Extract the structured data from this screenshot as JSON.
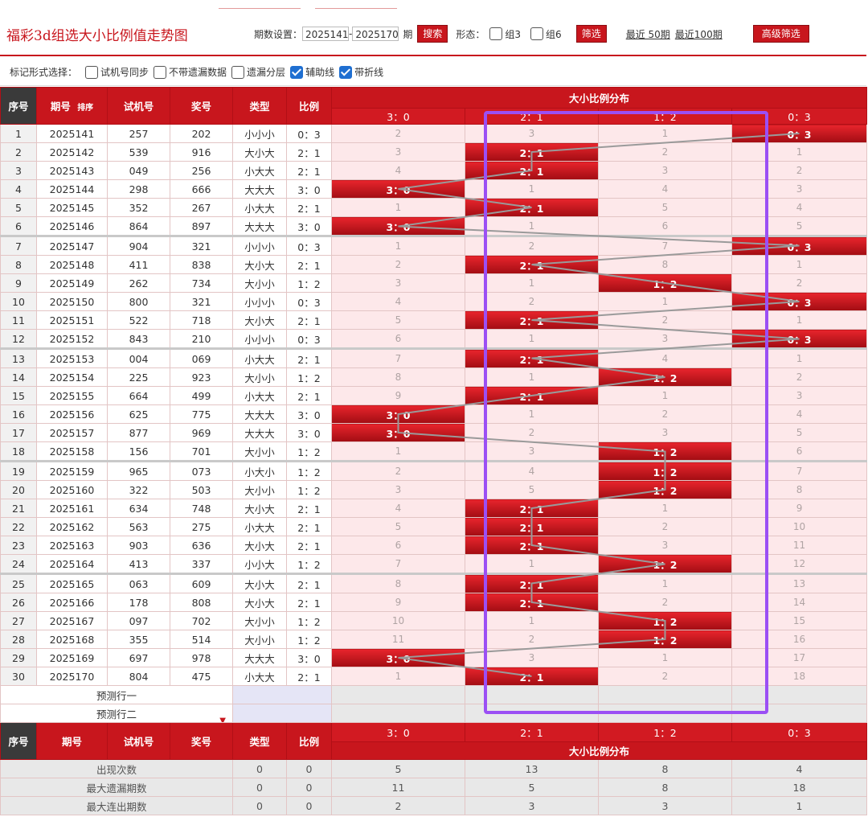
{
  "header": {
    "title": "福彩3d组选大小比例值走势图",
    "period_label": "期数设置：",
    "from": "2025141",
    "dash": "-",
    "to": "2025170",
    "qi": "期",
    "search": "搜索",
    "form_label": "形态：",
    "zu3": "组3",
    "zu6": "组6",
    "filter": "筛选",
    "recent50": "最近 50期",
    "recent100": "最近100期",
    "advanced": "高级筛选"
  },
  "markbar": {
    "label": "标记形式选择：",
    "opt1": "试机号同步",
    "opt2": "不带遗漏数据",
    "opt3": "遗漏分层",
    "opt4": "辅助线",
    "opt5": "带折线"
  },
  "table": {
    "h_seq": "序号",
    "h_issue": "期号",
    "h_sort": "排序",
    "h_trial": "试机号",
    "h_prize": "奖号",
    "h_type": "类型",
    "h_ratio": "比例",
    "h_dist": "大小比例分布",
    "ratios": [
      "3：0",
      "2：1",
      "1：2",
      "0：3"
    ],
    "rows": [
      {
        "seq": "1",
        "issue": "2025141",
        "trial": "257",
        "prize": "202",
        "type": "小小小",
        "ratio": "0：3",
        "c": [
          "2",
          "3",
          "1",
          "0：3"
        ],
        "hit": 3
      },
      {
        "seq": "2",
        "issue": "2025142",
        "trial": "539",
        "prize": "916",
        "type": "大小大",
        "ratio": "2：1",
        "c": [
          "3",
          "2：1",
          "2",
          "1"
        ],
        "hit": 1
      },
      {
        "seq": "3",
        "issue": "2025143",
        "trial": "049",
        "prize": "256",
        "type": "小大大",
        "ratio": "2：1",
        "c": [
          "4",
          "2：1",
          "3",
          "2"
        ],
        "hit": 1
      },
      {
        "seq": "4",
        "issue": "2025144",
        "trial": "298",
        "prize": "666",
        "type": "大大大",
        "ratio": "3：0",
        "c": [
          "3：0",
          "1",
          "4",
          "3"
        ],
        "hit": 0
      },
      {
        "seq": "5",
        "issue": "2025145",
        "trial": "352",
        "prize": "267",
        "type": "小大大",
        "ratio": "2：1",
        "c": [
          "1",
          "2：1",
          "5",
          "4"
        ],
        "hit": 1
      },
      {
        "seq": "6",
        "issue": "2025146",
        "trial": "864",
        "prize": "897",
        "type": "大大大",
        "ratio": "3：0",
        "c": [
          "3：0",
          "1",
          "6",
          "5"
        ],
        "hit": 0
      },
      {
        "seq": "7",
        "issue": "2025147",
        "trial": "904",
        "prize": "321",
        "type": "小小小",
        "ratio": "0：3",
        "c": [
          "1",
          "2",
          "7",
          "0：3"
        ],
        "hit": 3
      },
      {
        "seq": "8",
        "issue": "2025148",
        "trial": "411",
        "prize": "838",
        "type": "大小大",
        "ratio": "2：1",
        "c": [
          "2",
          "2：1",
          "8",
          "1"
        ],
        "hit": 1
      },
      {
        "seq": "9",
        "issue": "2025149",
        "trial": "262",
        "prize": "734",
        "type": "大小小",
        "ratio": "1：2",
        "c": [
          "3",
          "1",
          "1：2",
          "2"
        ],
        "hit": 2
      },
      {
        "seq": "10",
        "issue": "2025150",
        "trial": "800",
        "prize": "321",
        "type": "小小小",
        "ratio": "0：3",
        "c": [
          "4",
          "2",
          "1",
          "0：3"
        ],
        "hit": 3
      },
      {
        "seq": "11",
        "issue": "2025151",
        "trial": "522",
        "prize": "718",
        "type": "大小大",
        "ratio": "2：1",
        "c": [
          "5",
          "2：1",
          "2",
          "1"
        ],
        "hit": 1
      },
      {
        "seq": "12",
        "issue": "2025152",
        "trial": "843",
        "prize": "210",
        "type": "小小小",
        "ratio": "0：3",
        "c": [
          "6",
          "1",
          "3",
          "0：3"
        ],
        "hit": 3
      },
      {
        "seq": "13",
        "issue": "2025153",
        "trial": "004",
        "prize": "069",
        "type": "小大大",
        "ratio": "2：1",
        "c": [
          "7",
          "2：1",
          "4",
          "1"
        ],
        "hit": 1
      },
      {
        "seq": "14",
        "issue": "2025154",
        "trial": "225",
        "prize": "923",
        "type": "大小小",
        "ratio": "1：2",
        "c": [
          "8",
          "1",
          "1：2",
          "2"
        ],
        "hit": 2
      },
      {
        "seq": "15",
        "issue": "2025155",
        "trial": "664",
        "prize": "499",
        "type": "小大大",
        "ratio": "2：1",
        "c": [
          "9",
          "2：1",
          "1",
          "3"
        ],
        "hit": 1
      },
      {
        "seq": "16",
        "issue": "2025156",
        "trial": "625",
        "prize": "775",
        "type": "大大大",
        "ratio": "3：0",
        "c": [
          "3：0",
          "1",
          "2",
          "4"
        ],
        "hit": 0
      },
      {
        "seq": "17",
        "issue": "2025157",
        "trial": "877",
        "prize": "969",
        "type": "大大大",
        "ratio": "3：0",
        "c": [
          "3：0",
          "2",
          "3",
          "5"
        ],
        "hit": 0
      },
      {
        "seq": "18",
        "issue": "2025158",
        "trial": "156",
        "prize": "701",
        "type": "大小小",
        "ratio": "1：2",
        "c": [
          "1",
          "3",
          "1：2",
          "6"
        ],
        "hit": 2
      },
      {
        "seq": "19",
        "issue": "2025159",
        "trial": "965",
        "prize": "073",
        "type": "小大小",
        "ratio": "1：2",
        "c": [
          "2",
          "4",
          "1：2",
          "7"
        ],
        "hit": 2
      },
      {
        "seq": "20",
        "issue": "2025160",
        "trial": "322",
        "prize": "503",
        "type": "大小小",
        "ratio": "1：2",
        "c": [
          "3",
          "5",
          "1：2",
          "8"
        ],
        "hit": 2
      },
      {
        "seq": "21",
        "issue": "2025161",
        "trial": "634",
        "prize": "748",
        "type": "大小大",
        "ratio": "2：1",
        "c": [
          "4",
          "2：1",
          "1",
          "9"
        ],
        "hit": 1
      },
      {
        "seq": "22",
        "issue": "2025162",
        "trial": "563",
        "prize": "275",
        "type": "小大大",
        "ratio": "2：1",
        "c": [
          "5",
          "2：1",
          "2",
          "10"
        ],
        "hit": 1
      },
      {
        "seq": "23",
        "issue": "2025163",
        "trial": "903",
        "prize": "636",
        "type": "大小大",
        "ratio": "2：1",
        "c": [
          "6",
          "2：1",
          "3",
          "11"
        ],
        "hit": 1
      },
      {
        "seq": "24",
        "issue": "2025164",
        "trial": "413",
        "prize": "337",
        "type": "小小大",
        "ratio": "1：2",
        "c": [
          "7",
          "1",
          "1：2",
          "12"
        ],
        "hit": 2
      },
      {
        "seq": "25",
        "issue": "2025165",
        "trial": "063",
        "prize": "609",
        "type": "大小大",
        "ratio": "2：1",
        "c": [
          "8",
          "2：1",
          "1",
          "13"
        ],
        "hit": 1
      },
      {
        "seq": "26",
        "issue": "2025166",
        "trial": "178",
        "prize": "808",
        "type": "大小大",
        "ratio": "2：1",
        "c": [
          "9",
          "2：1",
          "2",
          "14"
        ],
        "hit": 1
      },
      {
        "seq": "27",
        "issue": "2025167",
        "trial": "097",
        "prize": "702",
        "type": "大小小",
        "ratio": "1：2",
        "c": [
          "10",
          "1",
          "1：2",
          "15"
        ],
        "hit": 2
      },
      {
        "seq": "28",
        "issue": "2025168",
        "trial": "355",
        "prize": "514",
        "type": "大小小",
        "ratio": "1：2",
        "c": [
          "11",
          "2",
          "1：2",
          "16"
        ],
        "hit": 2
      },
      {
        "seq": "29",
        "issue": "2025169",
        "trial": "697",
        "prize": "978",
        "type": "大大大",
        "ratio": "3：0",
        "c": [
          "3：0",
          "3",
          "1",
          "17"
        ],
        "hit": 0
      },
      {
        "seq": "30",
        "issue": "2025170",
        "trial": "804",
        "prize": "475",
        "type": "小大大",
        "ratio": "2：1",
        "c": [
          "1",
          "2：1",
          "2",
          "18"
        ],
        "hit": 1
      }
    ],
    "pred1": "预测行一",
    "pred2": "预测行二",
    "stats": [
      {
        "label": "出现次数",
        "type": "0",
        "ratio": "0",
        "c": [
          "5",
          "13",
          "8",
          "4"
        ]
      },
      {
        "label": "最大遗漏期数",
        "type": "0",
        "ratio": "0",
        "c": [
          "11",
          "5",
          "8",
          "18"
        ]
      },
      {
        "label": "最大连出期数",
        "type": "0",
        "ratio": "0",
        "c": [
          "2",
          "3",
          "3",
          "1"
        ]
      }
    ]
  },
  "colors": {
    "accent": "#c8161d",
    "highlight": "#9b4ff4",
    "link": "#9a9a9a"
  }
}
